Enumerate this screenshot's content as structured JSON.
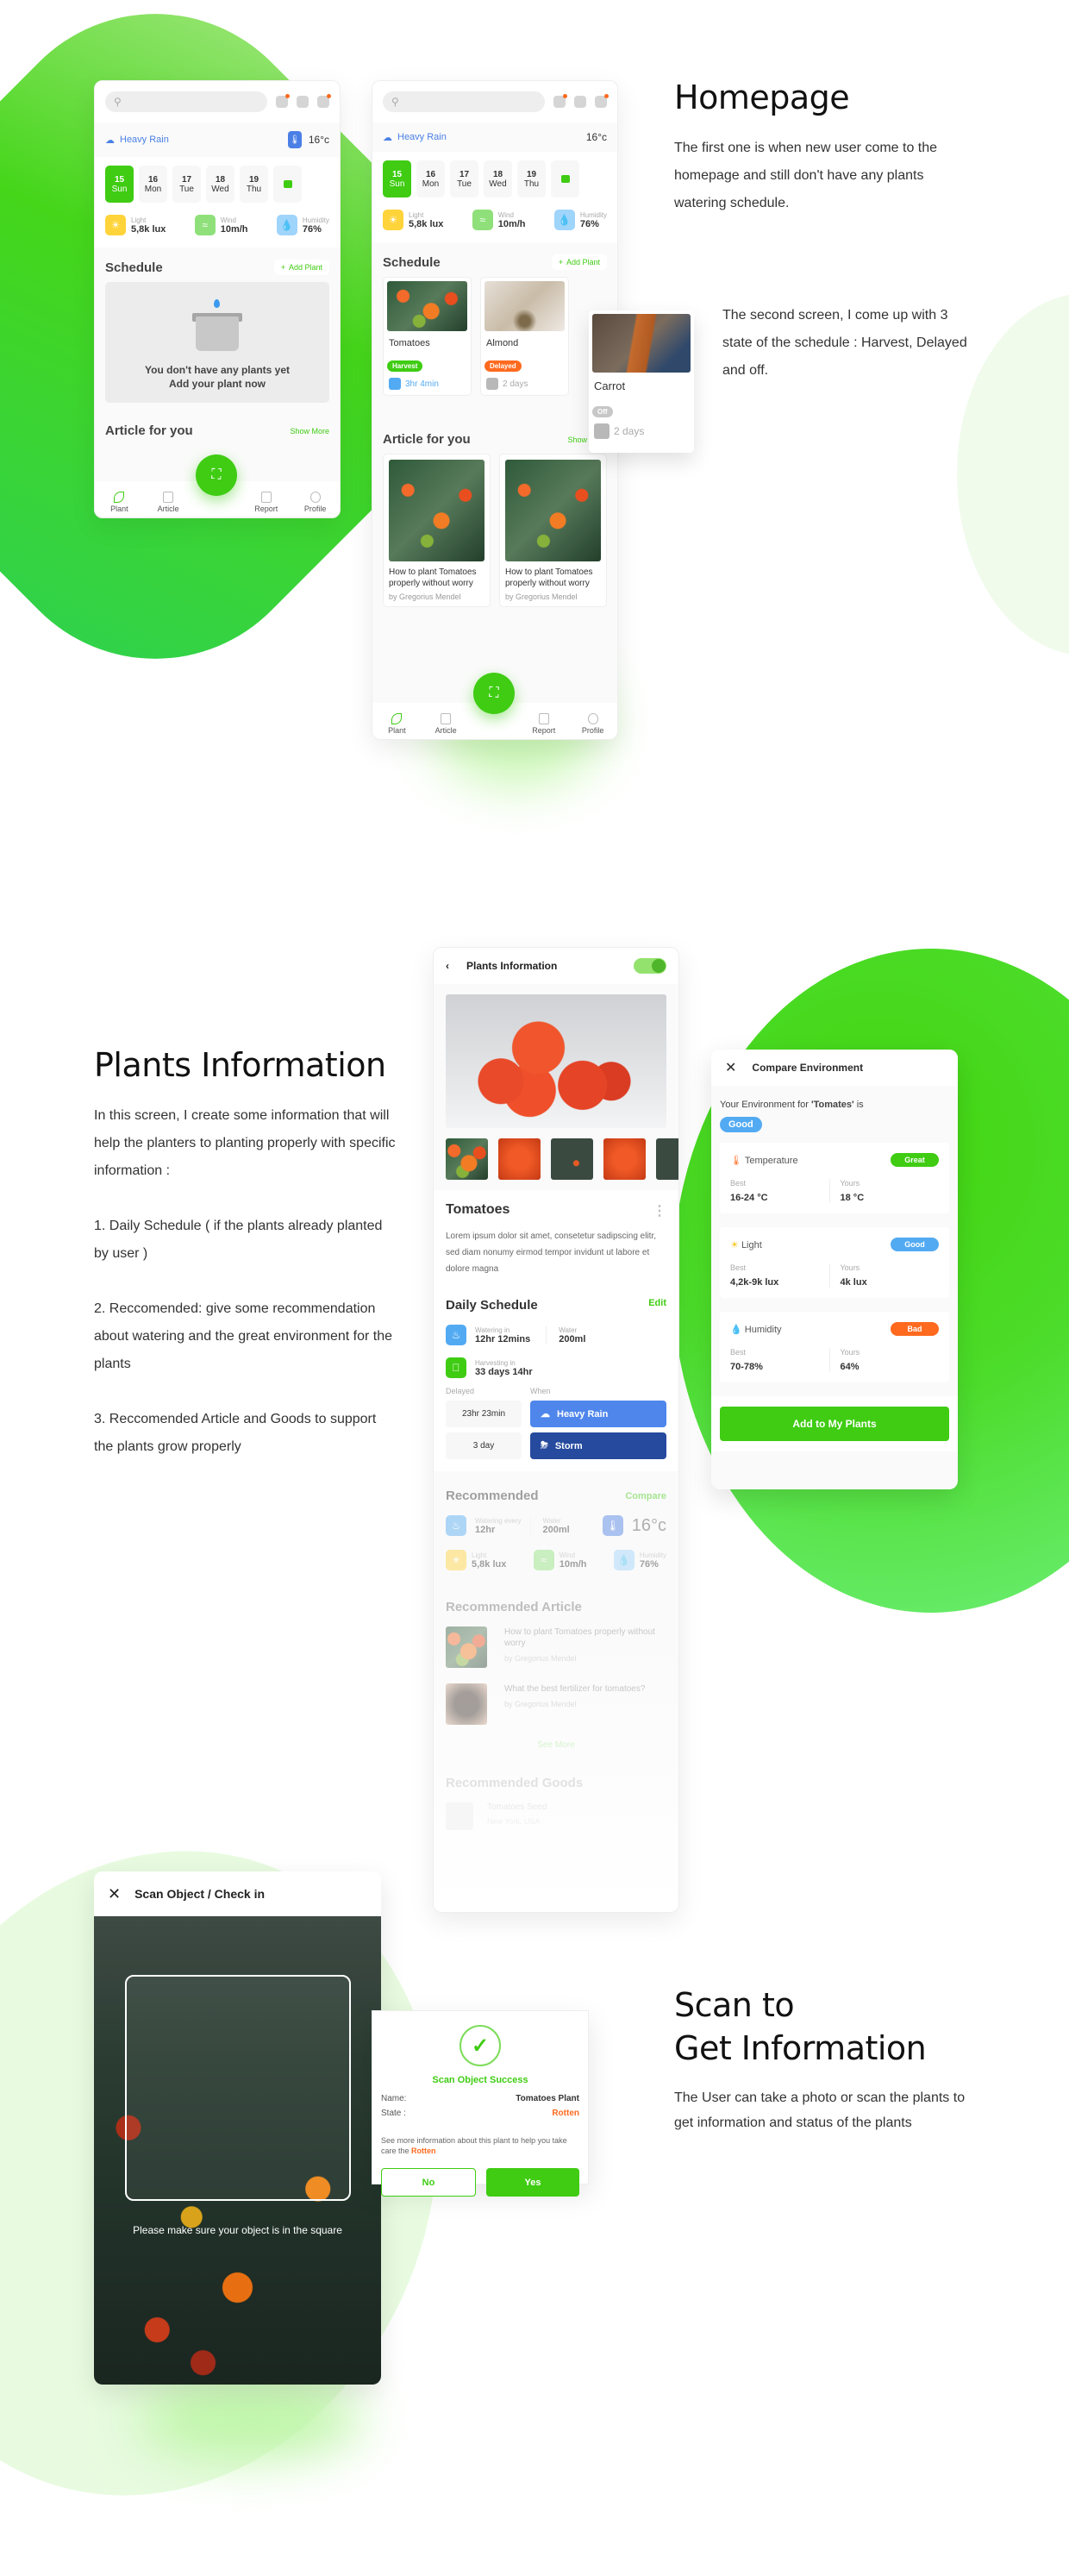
{
  "colors": {
    "accent": "#3fcc13",
    "blue": "#4a7fe6",
    "orange": "#ff6a1f",
    "navy": "#254a9e",
    "skyblue": "#52aaf2",
    "grey": "#b8b8b8"
  },
  "homepage": {
    "title": "Homepage",
    "desc1": "The first one is when new user come to the homepage and still don't have any plants watering schedule.",
    "desc2": "The second screen, I come up with 3 state of the schedule : Harvest, Delayed and off."
  },
  "home": {
    "search_placeholder": "",
    "weather": "Heavy Rain",
    "temperature": "16°c",
    "days": [
      {
        "num": "15",
        "name": "Sun",
        "active": true
      },
      {
        "num": "16",
        "name": "Mon"
      },
      {
        "num": "17",
        "name": "Tue"
      },
      {
        "num": "18",
        "name": "Wed"
      },
      {
        "num": "19",
        "name": "Thu"
      }
    ],
    "stats": [
      {
        "label": "Light",
        "value": "5,8k lux",
        "icon": "sun-icon"
      },
      {
        "label": "Wind",
        "value": "10m/h",
        "icon": "wind-icon"
      },
      {
        "label": "Humidity",
        "value": "76%",
        "icon": "drop-icon"
      }
    ],
    "schedule_title": "Schedule",
    "add_plant": "Add Plant",
    "empty_line1": "You don't have any plants yet",
    "empty_line2": "Add your plant now",
    "article_title": "Article for you",
    "show_more": "Show More",
    "nav": [
      "Plant",
      "Article",
      "Report",
      "Profile"
    ],
    "plants": [
      {
        "name": "Tomatoes",
        "state": "Harvest",
        "time": "3hr 4min"
      },
      {
        "name": "Almond",
        "state": "Delayed",
        "time": "2 days"
      },
      {
        "name": "Carrot",
        "state": "Off",
        "time": "2 days"
      }
    ],
    "articles": [
      {
        "title": "How to plant Tomatoes properly without worry",
        "author": "by Gregorius Mendel"
      },
      {
        "title": "How to plant Tomatoes properly without worry",
        "author": "by Gregorius Mendel"
      }
    ]
  },
  "plantsinfo": {
    "title": "Plants Information",
    "desc_intro": "In this screen, I create some information that will help the planters to planting properly with specific information :",
    "desc_1": "1. Daily Schedule ( if the plants already planted by user )",
    "desc_2": "2. Reccomended: give some recommendation about watering and the great environment for the plants",
    "desc_3": "3. Reccomended Article and Goods to support the plants grow properly"
  },
  "detail": {
    "header": "Plants Information",
    "name": "Tomatoes",
    "lorem": "Lorem ipsum dolor sit amet, consetetur sadipscing elitr, sed diam nonumy eirmod tempor invidunt ut labore et dolore magna",
    "daily_title": "Daily Schedule",
    "edit": "Edit",
    "watering_label": "Watering in",
    "watering_value": "12hr 12mins",
    "water_label": "Water",
    "water_value": "200ml",
    "harvest_label": "Harvesting in",
    "harvest_value": "33 days 14hr",
    "delayed_label": "Delayed",
    "when_label": "When",
    "delays": [
      {
        "duration": "23hr 23min",
        "when": "Heavy Rain"
      },
      {
        "duration": "3 day",
        "when": "Storm"
      }
    ],
    "rec_title": "Recommended",
    "compare": "Compare",
    "rec_watering_label": "Watering every",
    "rec_watering_value": "12hr",
    "rec_water_label": "Water",
    "rec_water_value": "200ml",
    "rec_temp": "16°c",
    "rec_stats": [
      {
        "label": "Light",
        "value": "5,8k lux"
      },
      {
        "label": "Wind",
        "value": "10m/h"
      },
      {
        "label": "Humidity",
        "value": "76%"
      }
    ],
    "rec_article_title": "Recommended Article",
    "rec_articles": [
      {
        "title": "How to plant Tomatoes properly without worry",
        "author": "by Gregorius Mendel"
      },
      {
        "title": "What the best fertilizer for tomatoes?",
        "author": "by Gregorius Mendel"
      }
    ],
    "see_more": "See More",
    "goods_title": "Recommended Goods",
    "goods": [
      {
        "name": "Tomatoes Seed",
        "location": "New York, USA"
      }
    ]
  },
  "compare": {
    "title": "Compare Environment",
    "intro_prefix": "Your Environment for ",
    "intro_plant": "'Tomates'",
    "intro_suffix": " is",
    "overall": "Good",
    "best_label": "Best",
    "yours_label": "Yours",
    "rows": [
      {
        "name": "Temperature",
        "rating": "Great",
        "best": "16-24 °C",
        "yours": "18 °C"
      },
      {
        "name": "Light",
        "rating": "Good",
        "best": "4,2k-9k lux",
        "yours": "4k lux"
      },
      {
        "name": "Humidity",
        "rating": "Bad",
        "best": "70-78%",
        "yours": "64%"
      }
    ],
    "button": "Add to My Plants"
  },
  "scan": {
    "header": "Scan Object / Check in",
    "hint": "Please make sure your object is in the square",
    "success_title": "Scan Object Success",
    "name_label": "Name:",
    "name_value": "Tomatoes Plant",
    "state_label": "State :",
    "state_value": "Rotten",
    "note_prefix": "See more information about this plant to help you take care the ",
    "note_state": "Rotten",
    "no": "No",
    "yes": "Yes"
  },
  "scansection": {
    "title_line1": "Scan to",
    "title_line2": "Get Information",
    "desc": "The User can take a photo or scan the plants to get information and status of the plants"
  }
}
